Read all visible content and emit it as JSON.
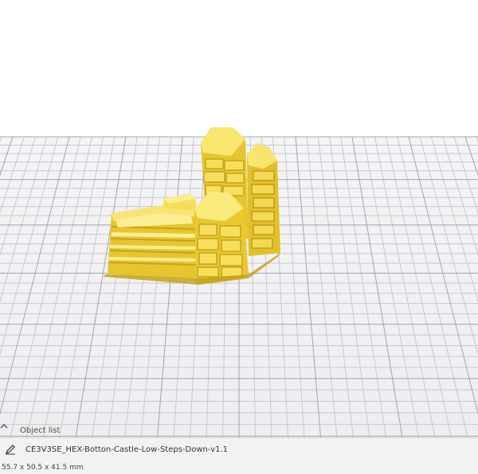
{
  "object_list": {
    "label": "Object list",
    "toggle_icon": "chevron-up-icon"
  },
  "object": {
    "name": "CE3V3SE_HEX-Botton-Castle-Low-Steps-Down-v1.1",
    "dimensions": "55.7 x 50.5 x 41.5 mm",
    "edit_icon": "pencil-icon"
  },
  "colors": {
    "model": "#f2d843",
    "grid": "#c9ccd3",
    "build_plate": "#f1f1f3"
  }
}
